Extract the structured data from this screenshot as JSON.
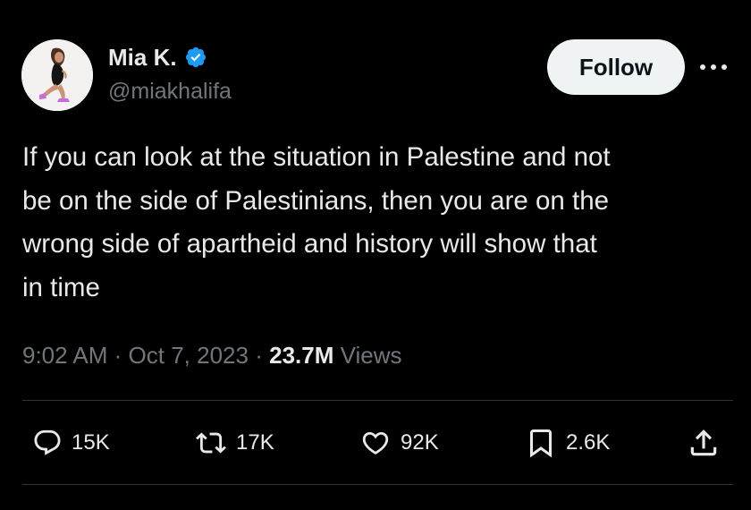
{
  "author": {
    "display_name": "Mia K.",
    "handle": "@miakhalifa",
    "verified": true,
    "verified_color": "#1d9bf0",
    "avatar_icon": "profile-photo"
  },
  "header": {
    "follow_label": "Follow",
    "more_icon": "more-options-icon"
  },
  "tweet": {
    "text": "If you can look at the situation in Palestine and not\nbe on the side of Palestinians, then you are on the\nwrong side of apartheid and history will show that\nin time"
  },
  "meta": {
    "time": "9:02 AM",
    "separator": "·",
    "date": "Oct 7, 2023",
    "views_count": "23.7M",
    "views_label": "Views"
  },
  "actions": {
    "replies": "15K",
    "reposts": "17K",
    "likes": "92K",
    "bookmarks": "2.6K"
  },
  "colors": {
    "background": "#000000",
    "primary_text": "#e7e9ea",
    "secondary_text": "#71767b",
    "divider": "#2f3336",
    "follow_bg": "#eff3f4"
  }
}
